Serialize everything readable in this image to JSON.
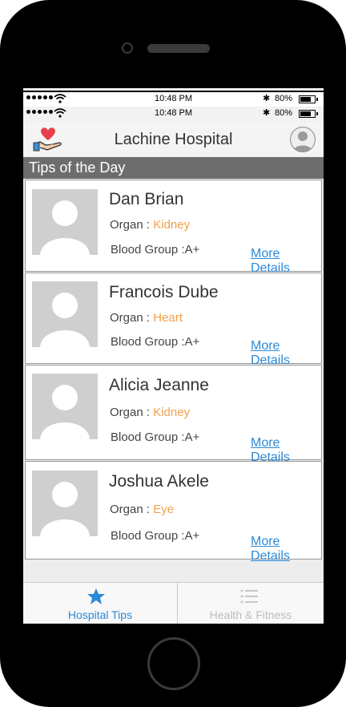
{
  "status": {
    "time": "10:48 PM",
    "battery": "80%"
  },
  "header": {
    "title": "Lachine Hospital"
  },
  "section": {
    "title": "Tips of the Day"
  },
  "labels": {
    "organ": "Organ : ",
    "more": "More Details"
  },
  "cards": [
    {
      "name": "Dan Brian",
      "organ": "Kidney",
      "blood": "Blood Group :A+"
    },
    {
      "name": "Francois Dube",
      "organ": "Heart",
      "blood": "Blood Group :A+"
    },
    {
      "name": "Alicia Jeanne",
      "organ": "Kidney",
      "blood": "Blood Group :A+"
    },
    {
      "name": "Joshua Akele",
      "organ": "Eye",
      "blood": "Blood Group :A+"
    }
  ],
  "tabs": [
    {
      "label": "Hospital Tips",
      "icon": "star-icon",
      "active": true
    },
    {
      "label": "Health & Fitness",
      "icon": "list-icon",
      "active": false
    }
  ],
  "colors": {
    "accent": "#2b8ad8",
    "organ": "#f0a04b",
    "section_bg": "#6d6d6d"
  }
}
